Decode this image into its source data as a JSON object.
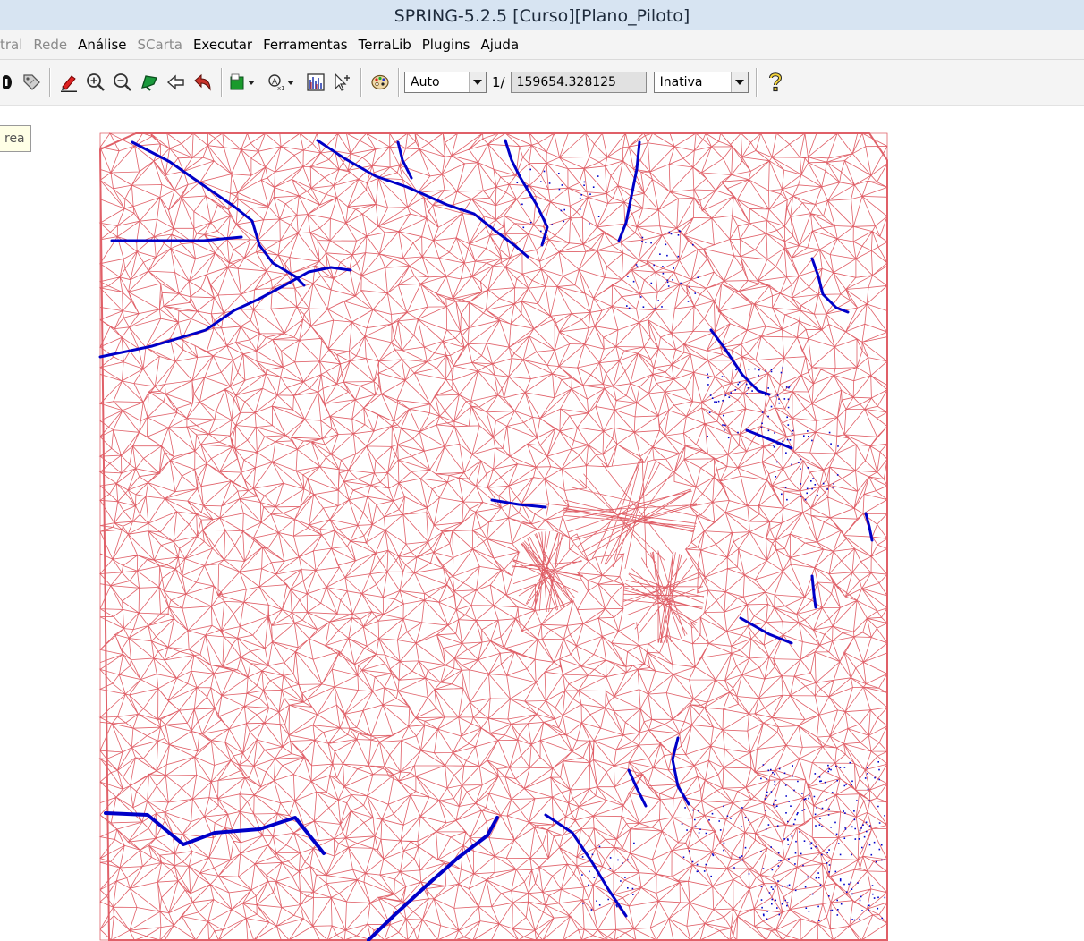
{
  "window": {
    "title": "SPRING-5.2.5 [Curso][Plano_Piloto]"
  },
  "menu": {
    "items": [
      {
        "label": "tral",
        "enabled": false
      },
      {
        "label": "Rede",
        "enabled": false
      },
      {
        "label": "Análise",
        "enabled": true
      },
      {
        "label": "SCarta",
        "enabled": false
      },
      {
        "label": "Executar",
        "enabled": true
      },
      {
        "label": "Ferramentas",
        "enabled": true
      },
      {
        "label": "TerraLib",
        "enabled": true
      },
      {
        "label": "Plugins",
        "enabled": true
      },
      {
        "label": "Ajuda",
        "enabled": true
      }
    ]
  },
  "toolbar": {
    "zoom_mode": "Auto",
    "scale_prefix": "1/",
    "scale_value": "159654.328125",
    "cursor_mode": "Inativa",
    "icons": [
      "info-icon",
      "tag-icon",
      "edit-pencil-icon",
      "zoom-in-icon",
      "zoom-out-icon",
      "zoom-area-icon",
      "pan-back-icon",
      "undo-icon",
      "layer-color-icon",
      "label-scale-icon",
      "histogram-icon",
      "select-pointer-icon",
      "palette-icon",
      "help-icon"
    ]
  },
  "tooltip": {
    "text": "rea"
  },
  "map": {
    "mesh_color": "#e06068",
    "line_color": "#0000c8",
    "background": "#ffffff"
  }
}
